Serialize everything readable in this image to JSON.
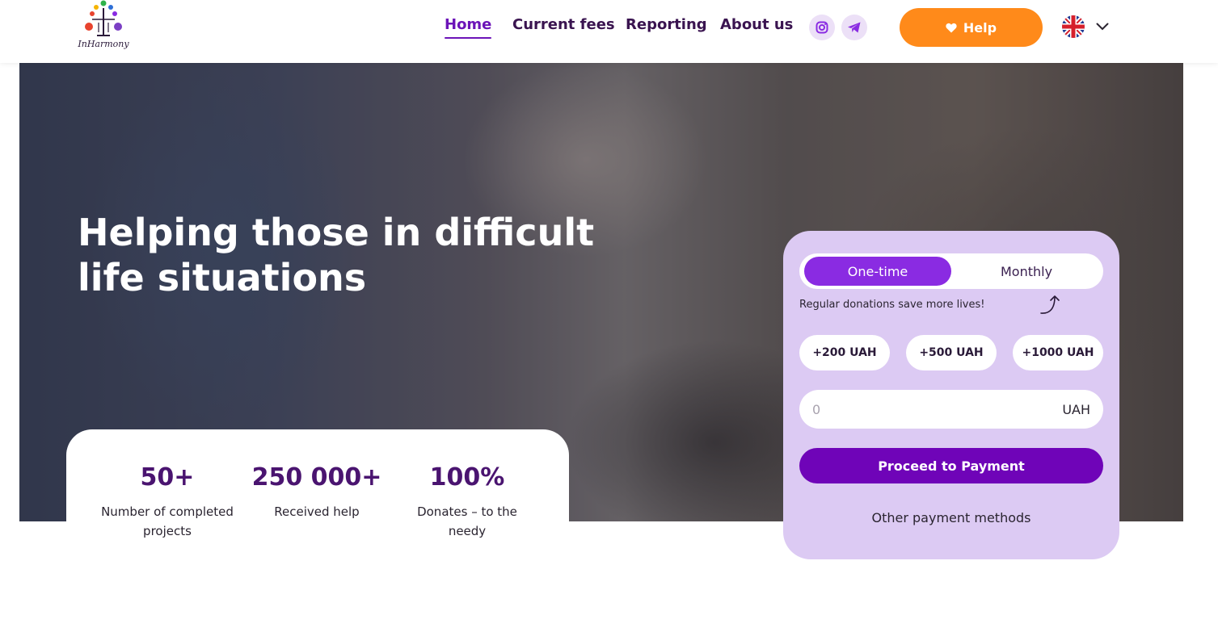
{
  "header": {
    "logo_text": "InHarmony",
    "nav": [
      {
        "label": "Home",
        "active": true
      },
      {
        "label": "Current fees",
        "active": false
      },
      {
        "label": "Reporting",
        "active": false
      },
      {
        "label": "About us",
        "active": false
      }
    ],
    "social_icons": [
      "instagram-icon",
      "telegram-icon"
    ],
    "help_label": "Help",
    "help_icon": "heart-icon",
    "language_icon": "uk-flag-icon"
  },
  "hero": {
    "title": "Helping those in difficult life situations"
  },
  "stats": [
    {
      "value": "50+",
      "label": "Number of completed projects"
    },
    {
      "value": "250 000+",
      "label": "Received help"
    },
    {
      "value": "100%",
      "label": "Donates – to the needy"
    }
  ],
  "donate": {
    "toggle": {
      "one_time": "One-time",
      "monthly": "Monthly",
      "selected": "One-time"
    },
    "note": "Regular donations save more lives!",
    "quick_amounts": [
      "+200 UAH",
      "+500 UAH",
      "+1000 UAH"
    ],
    "amount_placeholder": "0",
    "currency": "UAH",
    "proceed_label": "Proceed to Payment",
    "other_label": "Other payment methods"
  },
  "colors": {
    "accent": "#6f04b8",
    "toggle_active": "#8a2be2",
    "help_button": "#ff8a1a",
    "card_bg": "#dccaf3",
    "stat_number": "#4a1470"
  }
}
